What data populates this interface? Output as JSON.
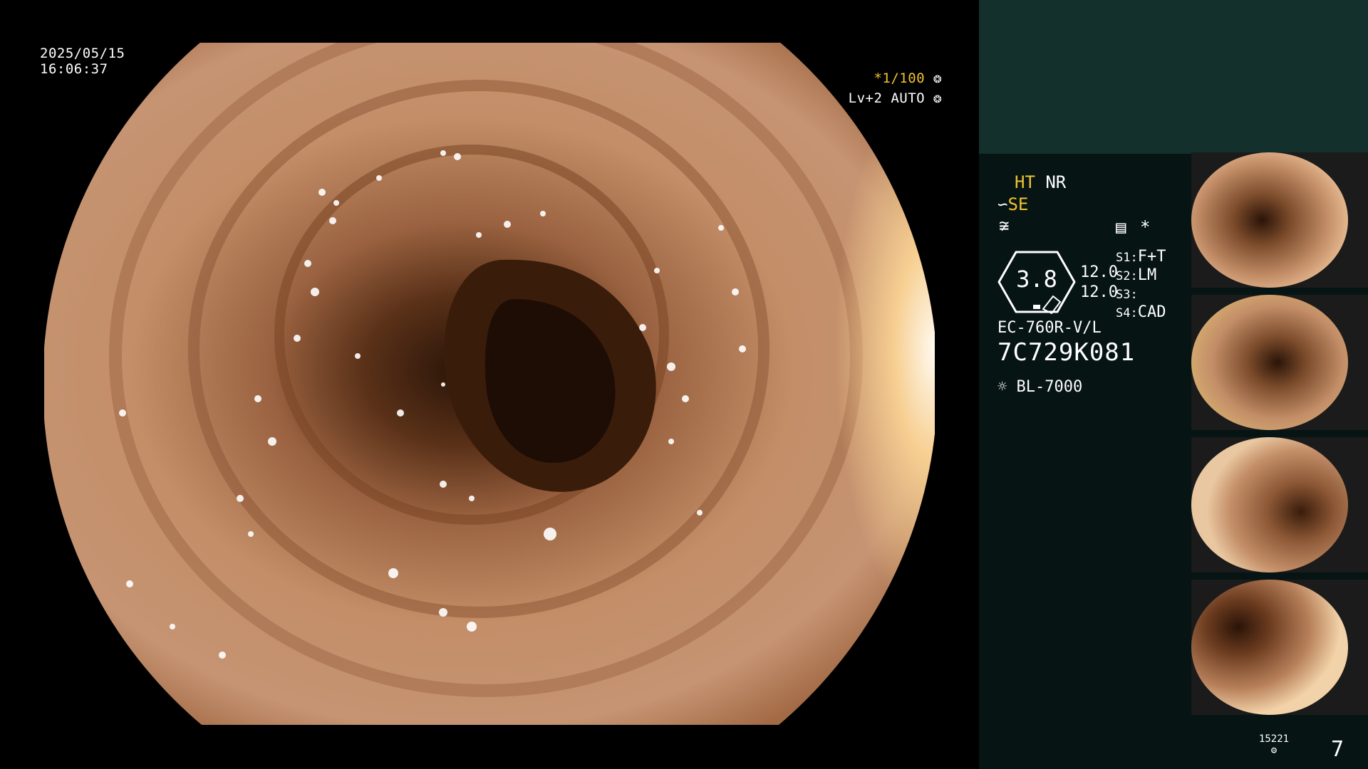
{
  "timestamp": {
    "date": "2025/05/15",
    "time": "16:06:37"
  },
  "shutter": {
    "value": "*1/100",
    "icon": "shutter-icon"
  },
  "iris": {
    "value": "Lv+2 AUTO",
    "icon": "iris-icon"
  },
  "modes": {
    "ht": "HT",
    "nr": "NR",
    "se": "SE"
  },
  "gauge": {
    "value": "3.8",
    "v1": "12.0",
    "v2": "12.0"
  },
  "switches": [
    {
      "label": "S1:",
      "value": "F+T"
    },
    {
      "label": "S2:",
      "value": "LM"
    },
    {
      "label": "S3:",
      "value": ""
    },
    {
      "label": "S4:",
      "value": "CAD"
    }
  ],
  "scope_model": "EC-760R-V/L",
  "serial": "7C729K081",
  "light_source": "BL-7000",
  "storage": {
    "label": "15221",
    "count": "7"
  },
  "colors": {
    "accent": "#f1c232",
    "panel_top": "#14302c",
    "panel": "#061413"
  }
}
